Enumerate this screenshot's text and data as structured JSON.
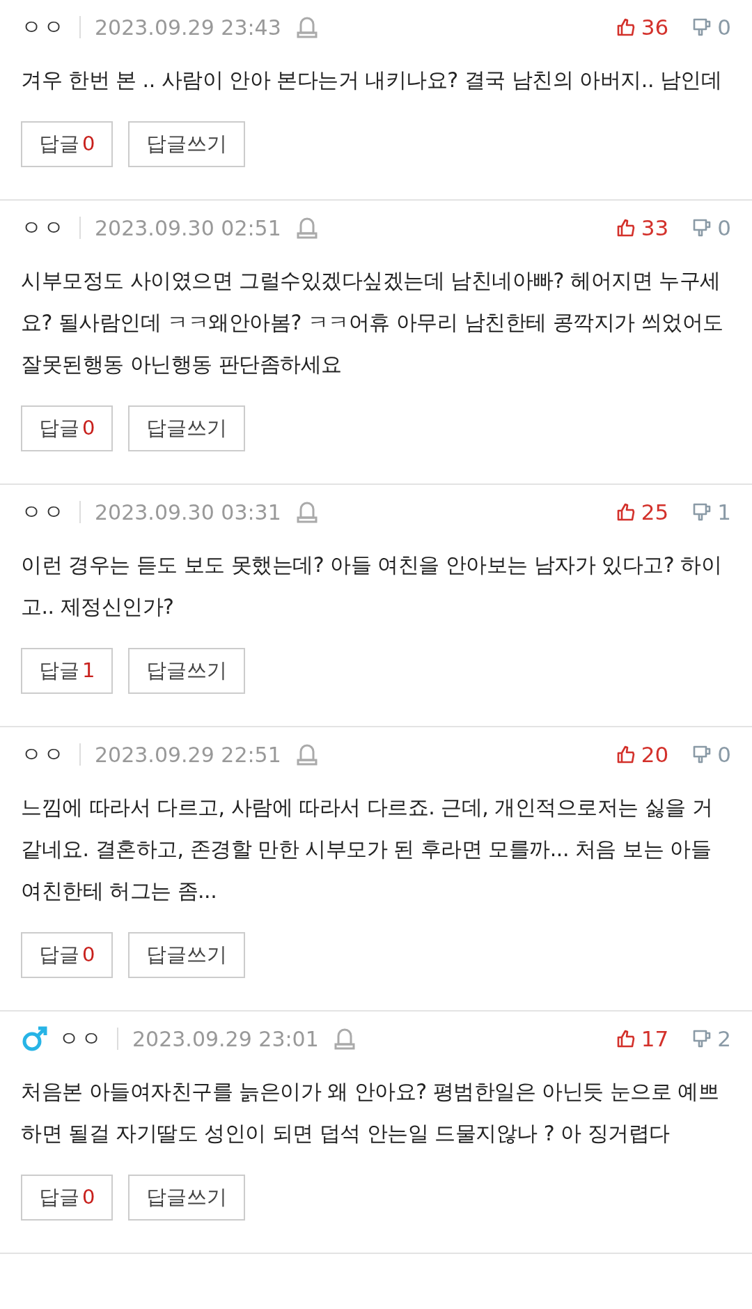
{
  "comments": [
    {
      "author": "ㅇㅇ",
      "date": "2023.09.29 23:43",
      "likes": "36",
      "dislikes": "0",
      "text": "겨우 한번 본 .. 사람이 안아 본다는거 내키나요? 결국 남친의 아버지.. 남인데",
      "reply_label": "답글",
      "reply_count": "0",
      "write_label": "답글쓰기"
    },
    {
      "author": "ㅇㅇ",
      "date": "2023.09.30 02:51",
      "likes": "33",
      "dislikes": "0",
      "text": "시부모정도 사이였으면 그럴수있겠다싶겠는데 남친네아빠? 헤어지면 누구세요? 될사람인데 ㅋㅋ왜안아봄? ㅋㅋ어휴 아무리 남친한테 콩깍지가 씌었어도 잘못된행동 아닌행동 판단좀하세요",
      "reply_label": "답글",
      "reply_count": "0",
      "write_label": "답글쓰기"
    },
    {
      "author": "ㅇㅇ",
      "date": "2023.09.30 03:31",
      "likes": "25",
      "dislikes": "1",
      "text": "이런 경우는 듣도 보도 못했는데? 아들 여친을 안아보는 남자가 있다고? 하이고.. 제정신인가?",
      "reply_label": "답글",
      "reply_count": "1",
      "write_label": "답글쓰기"
    },
    {
      "author": "ㅇㅇ",
      "date": "2023.09.29 22:51",
      "likes": "20",
      "dislikes": "0",
      "text": "느낌에 따라서 다르고, 사람에 따라서 다르죠. 근데, 개인적으로저는 싫을 거 같네요. 결혼하고, 존경할 만한 시부모가 된 후라면 모를까... 처음 보는 아들 여친한테 허그는 좀...",
      "reply_label": "답글",
      "reply_count": "0",
      "write_label": "답글쓰기"
    },
    {
      "author": "ㅇㅇ",
      "male": true,
      "date": "2023.09.29 23:01",
      "likes": "17",
      "dislikes": "2",
      "text": "처음본 아들여자친구를 늙은이가 왜 안아요? 평범한일은 아닌듯 눈으로 예쁘하면 될걸 자기딸도 성인이 되면 덥석 안는일 드물지않나 ? 아 징거렵다",
      "reply_label": "답글",
      "reply_count": "0",
      "write_label": "답글쓰기"
    }
  ]
}
